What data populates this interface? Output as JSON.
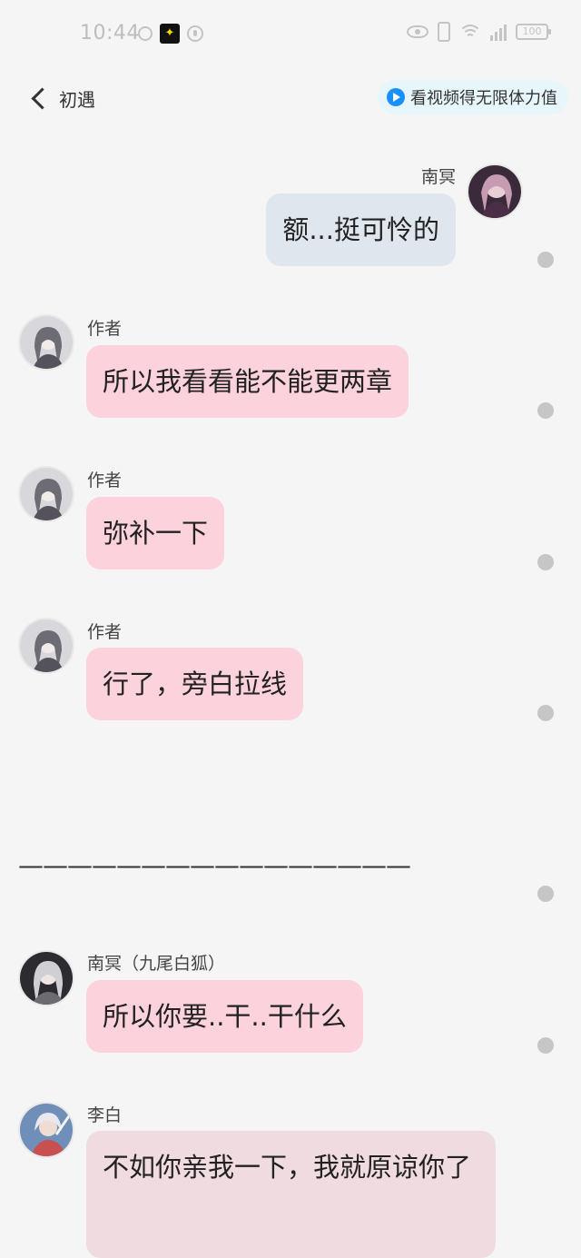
{
  "status_bar": {
    "time": "10:44",
    "battery": "100"
  },
  "header": {
    "back_label": "初遇",
    "video_reward_label": "看视频得无限体力值"
  },
  "messages": [
    {
      "sender": "南冥",
      "text": "额...挺可怜的",
      "side": "right",
      "bubble_color": "#dfe6ed"
    },
    {
      "sender": "作者",
      "text": "所以我看看能不能更两章",
      "side": "left",
      "bubble_color": "#fcd2dc"
    },
    {
      "sender": "作者",
      "text": "弥补一下",
      "side": "left",
      "bubble_color": "#fcd2dc"
    },
    {
      "sender": "作者",
      "text": "行了，旁白拉线",
      "side": "left",
      "bubble_color": "#fcd2dc"
    },
    {
      "sender": "南冥（九尾白狐）",
      "text": "所以你要..干..干什么",
      "side": "left",
      "bubble_color": "#fcd2dc"
    },
    {
      "sender": "李白",
      "text": "不如你亲我一下，我就原谅你了",
      "side": "left",
      "bubble_color": "#f0dbe0"
    }
  ],
  "divider": "————————————————",
  "colors": {
    "background": "#f5f5f5",
    "pink_bubble": "#fcd2dc",
    "blue_bubble": "#dfe6ed",
    "accent_blue": "#1990ff",
    "reward_bg": "#e7f6fb"
  }
}
